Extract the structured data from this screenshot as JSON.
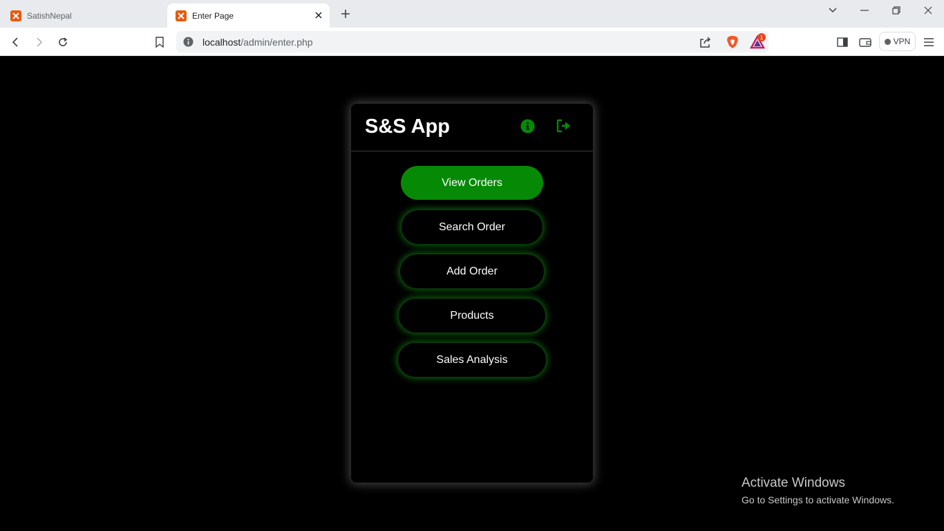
{
  "browser": {
    "tabs": [
      {
        "title": "SatishNepal",
        "active": false
      },
      {
        "title": "Enter Page",
        "active": true
      }
    ],
    "url": {
      "host": "localhost",
      "path": "/admin/enter.php"
    },
    "vpn_label": "VPN",
    "rewards_badge": "1"
  },
  "app": {
    "title": "S&S App",
    "accent_color": "#068a06",
    "buttons": [
      {
        "label": "View Orders",
        "primary": true
      },
      {
        "label": "Search Order",
        "primary": false
      },
      {
        "label": "Add Order",
        "primary": false
      },
      {
        "label": "Products",
        "primary": false
      },
      {
        "label": "Sales Analysis",
        "primary": false
      }
    ]
  },
  "watermark": {
    "title": "Activate Windows",
    "subtitle": "Go to Settings to activate Windows."
  }
}
